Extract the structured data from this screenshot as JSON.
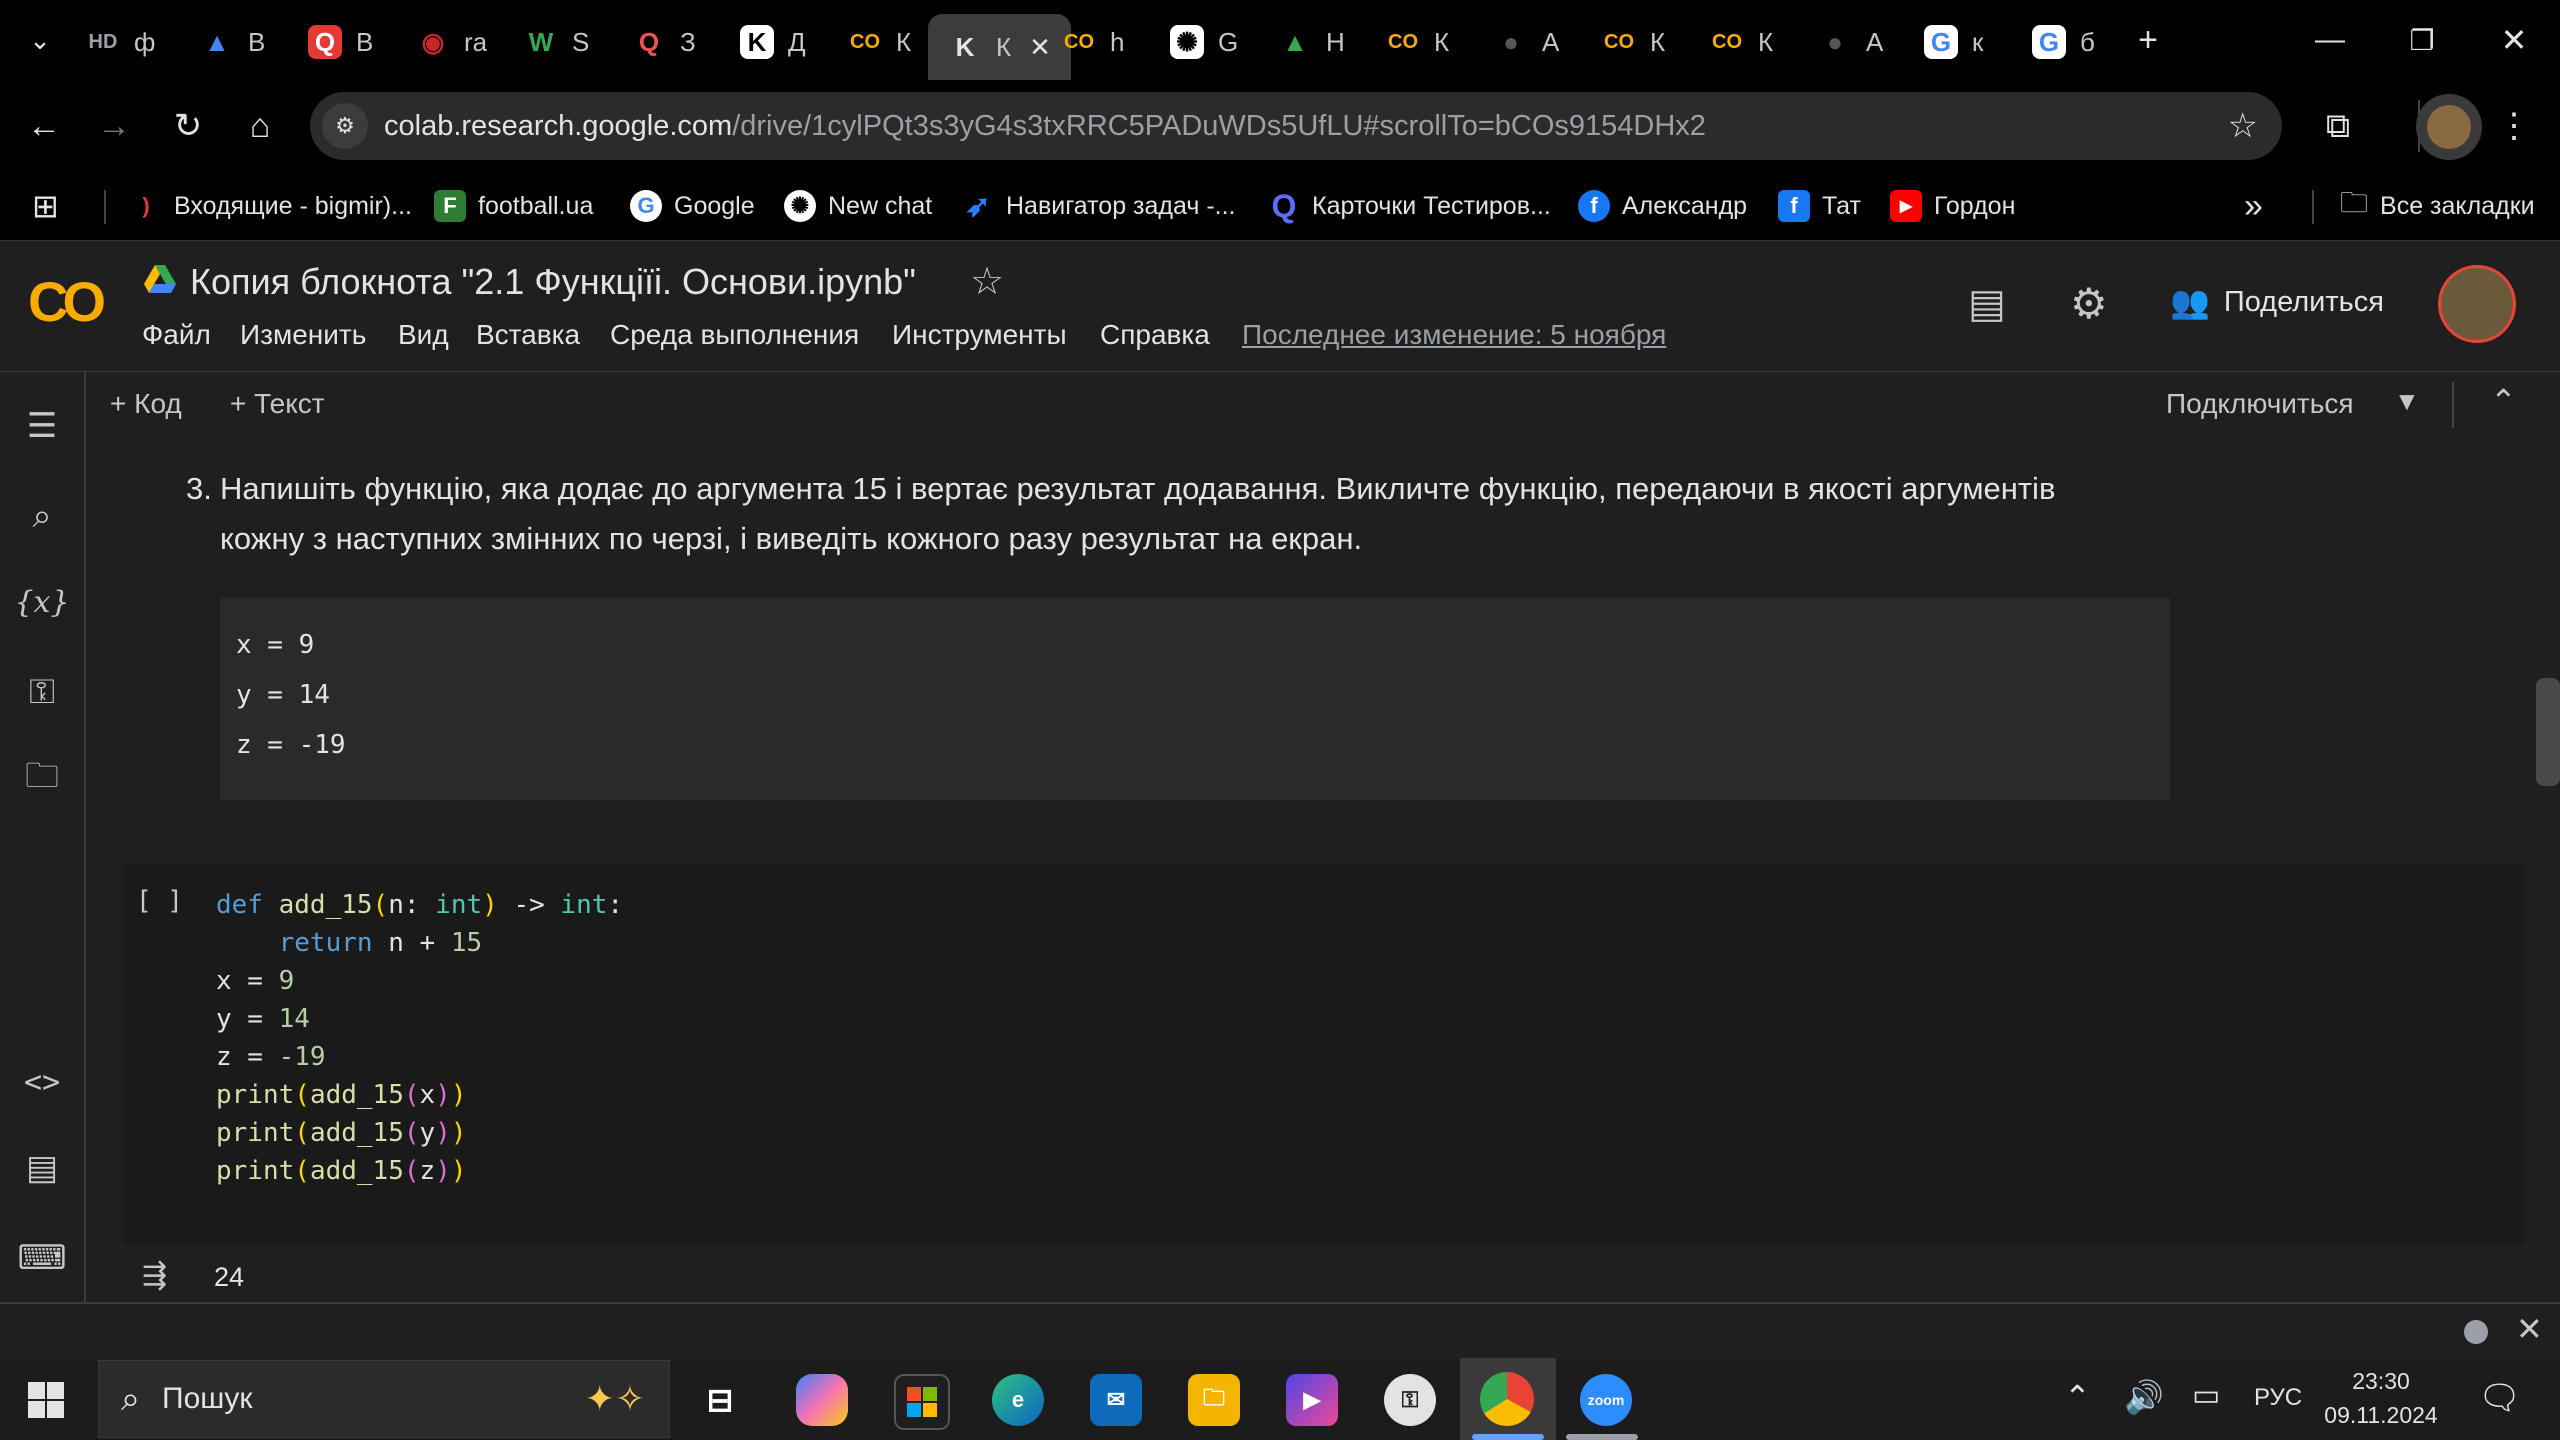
{
  "browser": {
    "tabs": [
      {
        "label": "ф",
        "icon": "hd-icon"
      },
      {
        "label": "В",
        "icon": "vector-icon"
      },
      {
        "label": "В",
        "icon": "q-red-icon"
      },
      {
        "label": "ra",
        "icon": "ra-icon"
      },
      {
        "label": "S",
        "icon": "w-icon"
      },
      {
        "label": "З",
        "icon": "search-q-icon"
      },
      {
        "label": "Д",
        "icon": "k-icon"
      },
      {
        "label": "К",
        "icon": "colab-icon"
      },
      {
        "label": "К",
        "icon": "k-active-icon"
      },
      {
        "label": "h",
        "icon": "colab-icon"
      },
      {
        "label": "G",
        "icon": "openai-icon"
      },
      {
        "label": "Н",
        "icon": "drive-icon"
      },
      {
        "label": "К",
        "icon": "colab-icon"
      },
      {
        "label": "А",
        "icon": "github-icon"
      },
      {
        "label": "К",
        "icon": "colab-icon"
      },
      {
        "label": "К",
        "icon": "colab-icon"
      },
      {
        "label": "А",
        "icon": "github-icon"
      },
      {
        "label": "к",
        "icon": "google-icon"
      },
      {
        "label": "б",
        "icon": "google-icon"
      }
    ],
    "url_host": "colab.research.google.com",
    "url_path": "/drive/1cylPQt3s3yG4s3txRRC5PADuWDs5UfLU#scrollTo=bCOs9154DHx2",
    "bookmarks": [
      "Входящие - bigmir)...",
      "football.ua",
      "Google",
      "New chat",
      "Навигатор задач -...",
      "Карточки Тестиров...",
      "Александр",
      "Тат",
      "Гордон"
    ],
    "all_bookmarks": "Все закладки",
    "overflow": "»"
  },
  "colab": {
    "logo": "CO",
    "title": "Копия блокнота \"2.1 Функціїі. Основи.ipynb\"",
    "menu": [
      "Файл",
      "Изменить",
      "Вид",
      "Вставка",
      "Среда выполнения",
      "Инструменты",
      "Справка"
    ],
    "last_edit": "Последнее изменение: 5 ноября",
    "share": "Поделиться",
    "add_code": "+ Код",
    "add_text": "+ Текст",
    "connect": "Подключиться"
  },
  "notebook": {
    "md_number": "3.",
    "md_line1": "Напишіть функцію, яка додає до аргумента 15 і вертає результат додавання. Викличте функцію, передаючи в якості аргументів",
    "md_line2": "кожну з наступних змінних по черзі, і виведіть кожного разу результат на екран.",
    "md_code": [
      "x = 9",
      "y = 14",
      "z = -19"
    ],
    "cell_run": "[ ]",
    "output": "24"
  },
  "taskbar": {
    "search_placeholder": "Пошук",
    "lang": "РУС",
    "time": "23:30",
    "date": "09.11.2024"
  },
  "colors": {
    "accent_orange": "#f9ab00",
    "keyword_blue": "#569cd6",
    "builtin_teal": "#4ec9b0",
    "number_green": "#b5cea8",
    "function_yellow": "#dcdcaa",
    "bracket_gold": "#ffd700"
  }
}
